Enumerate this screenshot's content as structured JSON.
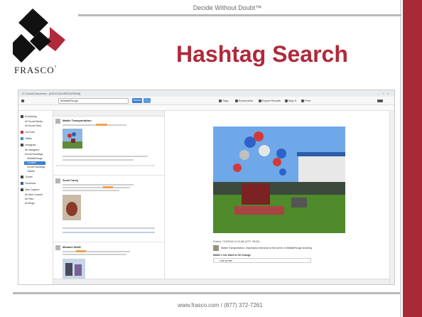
{
  "slide": {
    "tagline": "Decide Without Doubt™",
    "title": "Hashtag Search",
    "logo_text": "FRASCO",
    "footer": "www.frasco.com  /  (877) 372-7261",
    "colors": {
      "accent_red": "#a82a37",
      "title_red": "#b02a3a"
    }
  },
  "app": {
    "window_title": "IC Social Discovery - [#SOCIALMEDIAGRAM]",
    "search_value": "#MattieRouge",
    "search_button": "Search",
    "toolbar_items": [
      "Tags",
      "Bookmarks",
      "Export Results",
      "Map It",
      "Print"
    ],
    "sidebar": {
      "items": [
        "Everything",
        "All Social Media",
        "All Social Sites",
        "YouTube",
        "Twitter",
        "Instagram",
        "All Instagram",
        "Social Hashtags",
        "#MattieRouge",
        "Location",
        "Social Hashtags",
        "Tweets",
        "Tumblr",
        "Facebook",
        "Web Capture",
        "All Web Content",
        "All Files",
        "All Blogs"
      ]
    },
    "results": [
      {
        "name": "Mattie Transportation"
      },
      {
        "name": "Scott Carey"
      },
      {
        "name": "Melanie Wolff"
      }
    ],
    "detail": {
      "caption": "Posted: 7/19/2016 11:10 AM (UTC -05:00)",
      "comment": "Mattie Transportation: Impromptu memorial at the scene of #MattieRouge shooting.",
      "reply_label": "Mattie's Car Wash & Oil Change",
      "reply_text": "Lets be fine"
    }
  }
}
